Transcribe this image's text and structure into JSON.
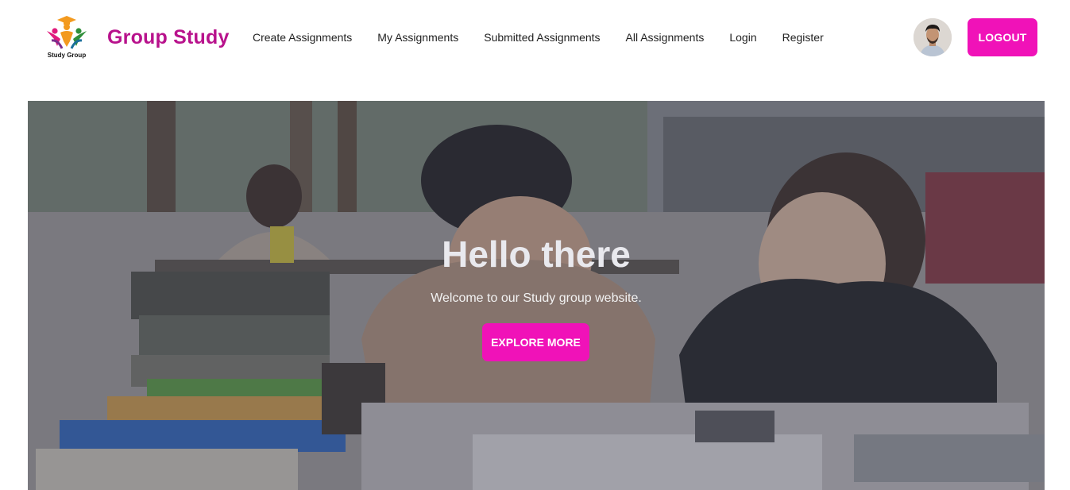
{
  "brand": {
    "logo_text": "Study Group",
    "name": "Group Study",
    "color": "#b8128c"
  },
  "nav": {
    "links": [
      {
        "label": "Create Assignments"
      },
      {
        "label": "My Assignments"
      },
      {
        "label": "Submitted Assignments"
      },
      {
        "label": "All Assignments"
      },
      {
        "label": "Login"
      },
      {
        "label": "Register"
      }
    ],
    "logout_label": "LOGOUT"
  },
  "hero": {
    "title": "Hello there",
    "subtitle": "Welcome to our Study group website.",
    "button_label": "EXPLORE MORE"
  },
  "theme": {
    "accent": "#f012b8"
  }
}
